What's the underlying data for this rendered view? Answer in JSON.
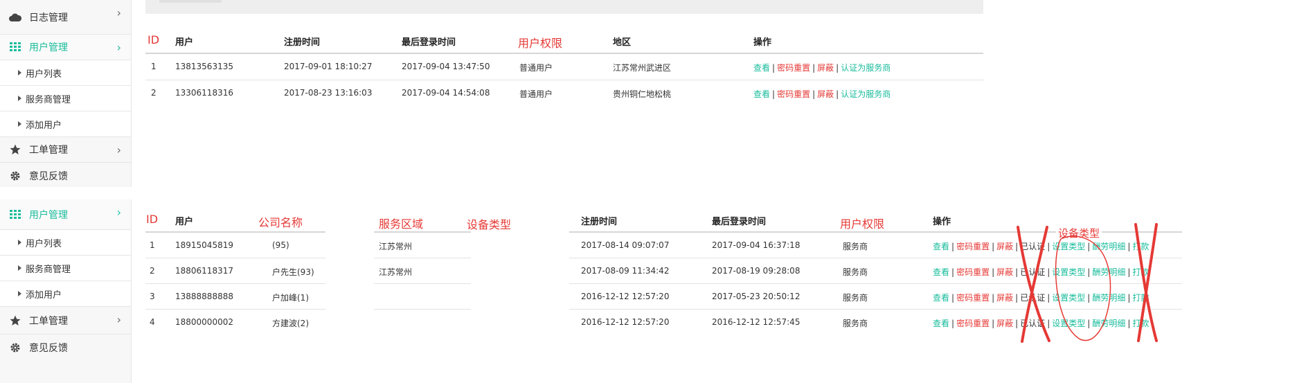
{
  "sidebar_top": {
    "items": [
      {
        "label": "日志管理",
        "icon": "cloud-icon"
      },
      {
        "label": "用户管理",
        "icon": "grid-icon"
      },
      {
        "label": "工单管理",
        "icon": "star-icon"
      },
      {
        "label": "意见反馈",
        "icon": "gear-icon"
      }
    ],
    "subitems": [
      "用户列表",
      "服务商管理",
      "添加用户"
    ]
  },
  "sidebar_bottom": {
    "items": [
      {
        "label": "用户管理",
        "icon": "grid-icon"
      },
      {
        "label": "工单管理",
        "icon": "star-icon"
      },
      {
        "label": "意见反馈",
        "icon": "gear-icon"
      }
    ],
    "subitems": [
      "用户列表",
      "服务商管理",
      "添加用户"
    ]
  },
  "table1": {
    "headers": {
      "id": "ID",
      "user": "用户",
      "reg_time": "注册时间",
      "last_login": "最后登录时间",
      "permission": "用户权限",
      "region": "地区",
      "actions": "操作"
    },
    "rows": [
      {
        "id": "1",
        "user": "13813563135",
        "reg_time": "2017-09-01 18:10:27",
        "last_login": "2017-09-04 13:47:50",
        "permission": "普通用户",
        "region": "江苏常州武进区"
      },
      {
        "id": "2",
        "user": "13306118316",
        "reg_time": "2017-08-23 13:16:03",
        "last_login": "2017-09-04 14:54:08",
        "permission": "普通用户",
        "region": "贵州铜仁地松桃"
      }
    ],
    "actions": {
      "view": "查看",
      "reset_pwd": "密码重置",
      "block": "屏蔽",
      "certify": "认证为服务商"
    }
  },
  "table2": {
    "headers": {
      "id": "ID",
      "user": "用户",
      "company": "公司名称",
      "service_area": "服务区域",
      "device_type": "设备类型",
      "reg_time": "注册时间",
      "last_login": "最后登录时间",
      "permission": "用户权限",
      "actions": "操作"
    },
    "rows": [
      {
        "id": "1",
        "user": "18915045819",
        "company": "(95)",
        "service_area": "江苏常州",
        "reg_time": "2017-08-14 09:07:07",
        "last_login": "2017-09-04 16:37:18",
        "permission": "服务商"
      },
      {
        "id": "2",
        "user": "18806118317",
        "company": "户先生(93)",
        "service_area": "江苏常州",
        "reg_time": "2017-08-09 11:34:42",
        "last_login": "2017-08-19 09:28:08",
        "permission": "服务商"
      },
      {
        "id": "3",
        "user": "13888888888",
        "company": "户加峰(1)",
        "service_area": "",
        "reg_time": "2016-12-12 12:57:20",
        "last_login": "2017-05-23 20:50:12",
        "permission": "服务商"
      },
      {
        "id": "4",
        "user": "18800000002",
        "company": "方建波(2)",
        "service_area": "",
        "reg_time": "2016-12-12 12:57:20",
        "last_login": "2016-12-12 12:57:45",
        "permission": "服务商"
      }
    ],
    "actions": {
      "view": "查看",
      "reset_pwd": "密码重置",
      "block": "屏蔽",
      "certified": "已认证",
      "set_device": "设置类型",
      "detail": "酬劳明细",
      "print": "打款"
    },
    "annotation_label": "设备类型"
  }
}
